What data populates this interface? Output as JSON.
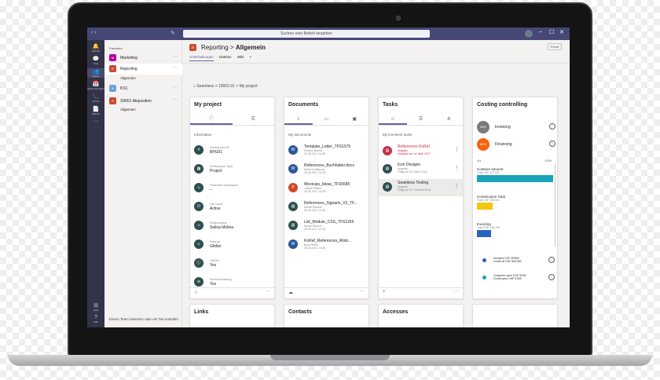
{
  "topbar": {
    "search_placeholder": "Suchen oder Befehl eingeben",
    "nav": "‹ ›",
    "compose": "✎",
    "win_min": "–",
    "win_max": "☐",
    "win_close": "✕"
  },
  "rail": [
    {
      "icon": "🔔",
      "label": "Aktivität"
    },
    {
      "icon": "💬",
      "label": "Chat"
    },
    {
      "icon": "👥",
      "label": "Teams"
    },
    {
      "icon": "📅",
      "label": "Besprechungen"
    },
    {
      "icon": "📞",
      "label": "Anrufe"
    },
    {
      "icon": "📄",
      "label": "Dateien"
    },
    {
      "icon": "···",
      "label": ""
    }
  ],
  "rail_bottom": [
    {
      "icon": "⊞",
      "label": "Apps"
    },
    {
      "icon": "?",
      "label": "Hilfe"
    }
  ],
  "teams_list": {
    "header": "Favoriten",
    "teams": [
      {
        "abbr": "M",
        "name": "Marketing",
        "color": "#b4009e"
      },
      {
        "abbr": "R",
        "name": "Reporting",
        "color": "#cc4a31",
        "channel": "Allgemein"
      },
      {
        "abbr": "K",
        "name": "KS1",
        "color": "#6fa1d8"
      },
      {
        "abbr": "S",
        "name": "S9001 Akquisition",
        "color": "#cc4a31",
        "channel": "Allgemein"
      }
    ],
    "more": "···",
    "join_label": "Einem Team beitreten oder ein Tea erstellen"
  },
  "channel": {
    "icon": "R",
    "team": "Reporting",
    "separator": " > ",
    "name": "Allgemein",
    "tabs": [
      "Unterhaltungen",
      "Dateien",
      "Wiki",
      "+"
    ],
    "private": "Privat"
  },
  "breadcrumb": "Seamless  >  19002.01  >  My project",
  "my_project": {
    "title": "My project",
    "section": "Information",
    "props": [
      {
        "icon": "#",
        "label": "Workspace ID",
        "value": "BPG01"
      },
      {
        "icon": "▦",
        "label": "Workspace Type",
        "value": "Project"
      },
      {
        "icon": "⤷",
        "label": "Parented workspace",
        "value": "–"
      },
      {
        "icon": "⏻",
        "label": "Life cycle",
        "value": "Active"
      },
      {
        "icon": "☺",
        "label": "Responsible",
        "value": "Selina Molina"
      },
      {
        "icon": "☺",
        "label": "Deputy",
        "value": "Gfeller"
      },
      {
        "icon": "ⓘ",
        "label": "Visible",
        "value": "Yes"
      },
      {
        "icon": "⊘",
        "label": "Internal sharing",
        "value": "Yes"
      }
    ]
  },
  "documents": {
    "title": "Documents",
    "section": "My documents",
    "items": [
      {
        "name": "Template_Letter_TFS1575",
        "author": "Roland Steiner",
        "date": "30.05.2017 14:05",
        "color": "#2b579a"
      },
      {
        "name": "References_Buchhalter.docx",
        "author": "Edwin Kohlbrunn",
        "date": "30.05.2017 14:05",
        "color": "#2b579a"
      },
      {
        "name": "Mockups_Ideas_TFS5685",
        "author": "Janine Steiner",
        "date": "30.05.2017 14:05",
        "color": "#d24726"
      },
      {
        "name": "References_Signaris_V2_TF...",
        "author": "Daniel Rüesch",
        "date": "30.05.2017 14:05",
        "color": "#2f4f4f"
      },
      {
        "name": "List_Module_CSS_TFS1256",
        "author": "Daniel Rüesch",
        "date": "30.05.2017 14:05",
        "color": "#2f4f4f"
      },
      {
        "name": "KoRef_References_Mobi...",
        "author": "Beat Pfister",
        "date": "30.05.2017 14:05",
        "color": "#2b579a"
      }
    ]
  },
  "tasks": {
    "title": "Tasks",
    "section": "My imminent tasks",
    "items": [
      {
        "name": "References KoRef",
        "type": "Aufgabe",
        "date": "Vergallet am 14. April 2017",
        "overdue": true,
        "color": "#c4314b"
      },
      {
        "name": "Icon Designs",
        "type": "Aufgabe",
        "date": "Fällig am 29. März 2018",
        "overdue": false,
        "color": "#2f4f4f"
      },
      {
        "name": "Seamless Testing",
        "type": "Aufgabe",
        "date": "Fällig am 12. Februar 2018",
        "overdue": false,
        "color": "#2f4f4f"
      }
    ],
    "more": "⋮",
    "add": "+"
  },
  "costing": {
    "title": "Costing controlling",
    "rows": [
      {
        "pct": "94%",
        "label": "Invoicing",
        "color": "#7a7a7a"
      },
      {
        "pct": "85%",
        "label": "Financing",
        "color": "#f7630c"
      }
    ],
    "axis_min": "0%",
    "axis_max": "100%",
    "bars": [
      {
        "label": "Contract amount",
        "sub": "Total CHF 427'051",
        "fraction": 0.97,
        "color": "#1aa3b8"
      },
      {
        "label": "Construction Total",
        "sub": "Total CHF 350'351",
        "fraction": 0.2,
        "color": "#f2c811"
      },
      {
        "label": "Invoicing",
        "sub": "Total CHF 148'758",
        "fraction": 0.18,
        "color": "#2c62bf"
      }
    ],
    "legend": [
      {
        "line1": "Invoiced CHF 28'593",
        "line2": "Credit off CHF 500'000",
        "color": "#2c62bf"
      },
      {
        "line1": "Customer open CHF 5'000",
        "line2": "Credit open CHF 5'000",
        "color": "#1aa3b8"
      }
    ]
  },
  "bottom_cards": [
    {
      "title": "Links"
    },
    {
      "title": "Contacts"
    },
    {
      "title": "Accesses"
    },
    {
      "title": ""
    }
  ]
}
